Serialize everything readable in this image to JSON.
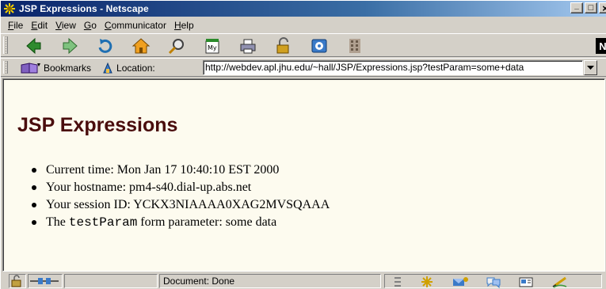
{
  "window": {
    "title": "JSP Expressions - Netscape",
    "controls": {
      "minimize": "_",
      "maximize": "□",
      "close": "×"
    }
  },
  "menubar": [
    {
      "key": "F",
      "rest": "ile"
    },
    {
      "key": "E",
      "rest": "dit"
    },
    {
      "key": "V",
      "rest": "iew"
    },
    {
      "key": "G",
      "rest": "o"
    },
    {
      "key": "C",
      "rest": "ommunicator"
    },
    {
      "key": "H",
      "rest": "elp"
    }
  ],
  "navToolbar": {
    "icons": [
      "back-icon",
      "forward-icon",
      "reload-icon",
      "home-icon",
      "search-icon",
      "my-netscape-icon",
      "print-icon",
      "security-icon",
      "shop-icon",
      "stop-icon"
    ],
    "logo": "N"
  },
  "locationToolbar": {
    "bookmarks_label": "Bookmarks",
    "location_label": "Location:",
    "url": "http://webdev.apl.jhu.edu/~hall/JSP/Expressions.jsp?testParam=some+data"
  },
  "page": {
    "heading": "JSP Expressions",
    "items": [
      {
        "label": "Current time: ",
        "value": "Mon Jan 17 10:40:10 EST 2000"
      },
      {
        "label": "Your hostname: ",
        "value": "pm4-s40.dial-up.abs.net"
      },
      {
        "label": "Your session ID: ",
        "value": "YCKX3NIAAAA0XAG2MVSQAAA"
      },
      {
        "prefix": "The ",
        "code": "testParam",
        "suffix": " form parameter: some data"
      }
    ]
  },
  "statusbar": {
    "status": "Document: Done"
  },
  "colors": {
    "titlebar_start": "#0a246a",
    "titlebar_end": "#a6caf0",
    "content_bg": "#fdfbef",
    "heading": "#4a0d0d"
  }
}
